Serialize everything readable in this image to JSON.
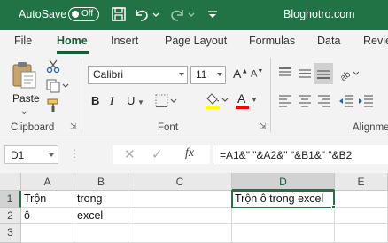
{
  "titlebar": {
    "autosave_label": "AutoSave",
    "toggle_state": "Off",
    "site": "Bloghotro.com",
    "colors": {
      "bg": "#217346",
      "text": "#ffffff"
    }
  },
  "tabs": [
    "File",
    "Home",
    "Insert",
    "Page Layout",
    "Formulas",
    "Data",
    "Revie"
  ],
  "active_tab": "Home",
  "ribbon": {
    "clipboard": {
      "paste_label": "Paste",
      "group_label": "Clipboard"
    },
    "font": {
      "name": "Calibri",
      "size": "11",
      "group_label": "Font",
      "bold": "B",
      "italic": "I",
      "underline": "U",
      "grow": "A",
      "shrink": "A",
      "font_color": "A"
    },
    "alignment": {
      "group_label": "Alignme"
    },
    "accent_colors": {
      "highlight": "#ffff00",
      "font_color": "#ff0000"
    }
  },
  "formula_bar": {
    "name_box": "D1",
    "fx_label": "fx",
    "formula": "=A1&\" \"&A2&\" \"&B1&\" \"&B2"
  },
  "grid": {
    "columns": [
      "A",
      "B",
      "C",
      "D",
      "E"
    ],
    "rows": [
      "1",
      "2",
      "3"
    ],
    "cells": {
      "A1": "Trộn",
      "B1": "trong",
      "C1": "",
      "D1": "Trộn ô trong excel",
      "E1": "",
      "A2": "ô",
      "B2": "excel",
      "C2": "",
      "D2": "",
      "E2": ""
    },
    "active_cell": "D1",
    "selection_color": "#217346"
  }
}
